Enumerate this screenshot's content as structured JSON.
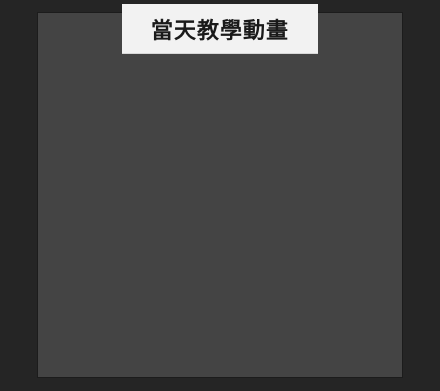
{
  "title_card": {
    "text": "當天教學動畫"
  },
  "colors": {
    "outer_background": "#252525",
    "canvas": "#444444",
    "title_card_background": "#f2f2f2",
    "title_text": "#1a1a1a"
  }
}
